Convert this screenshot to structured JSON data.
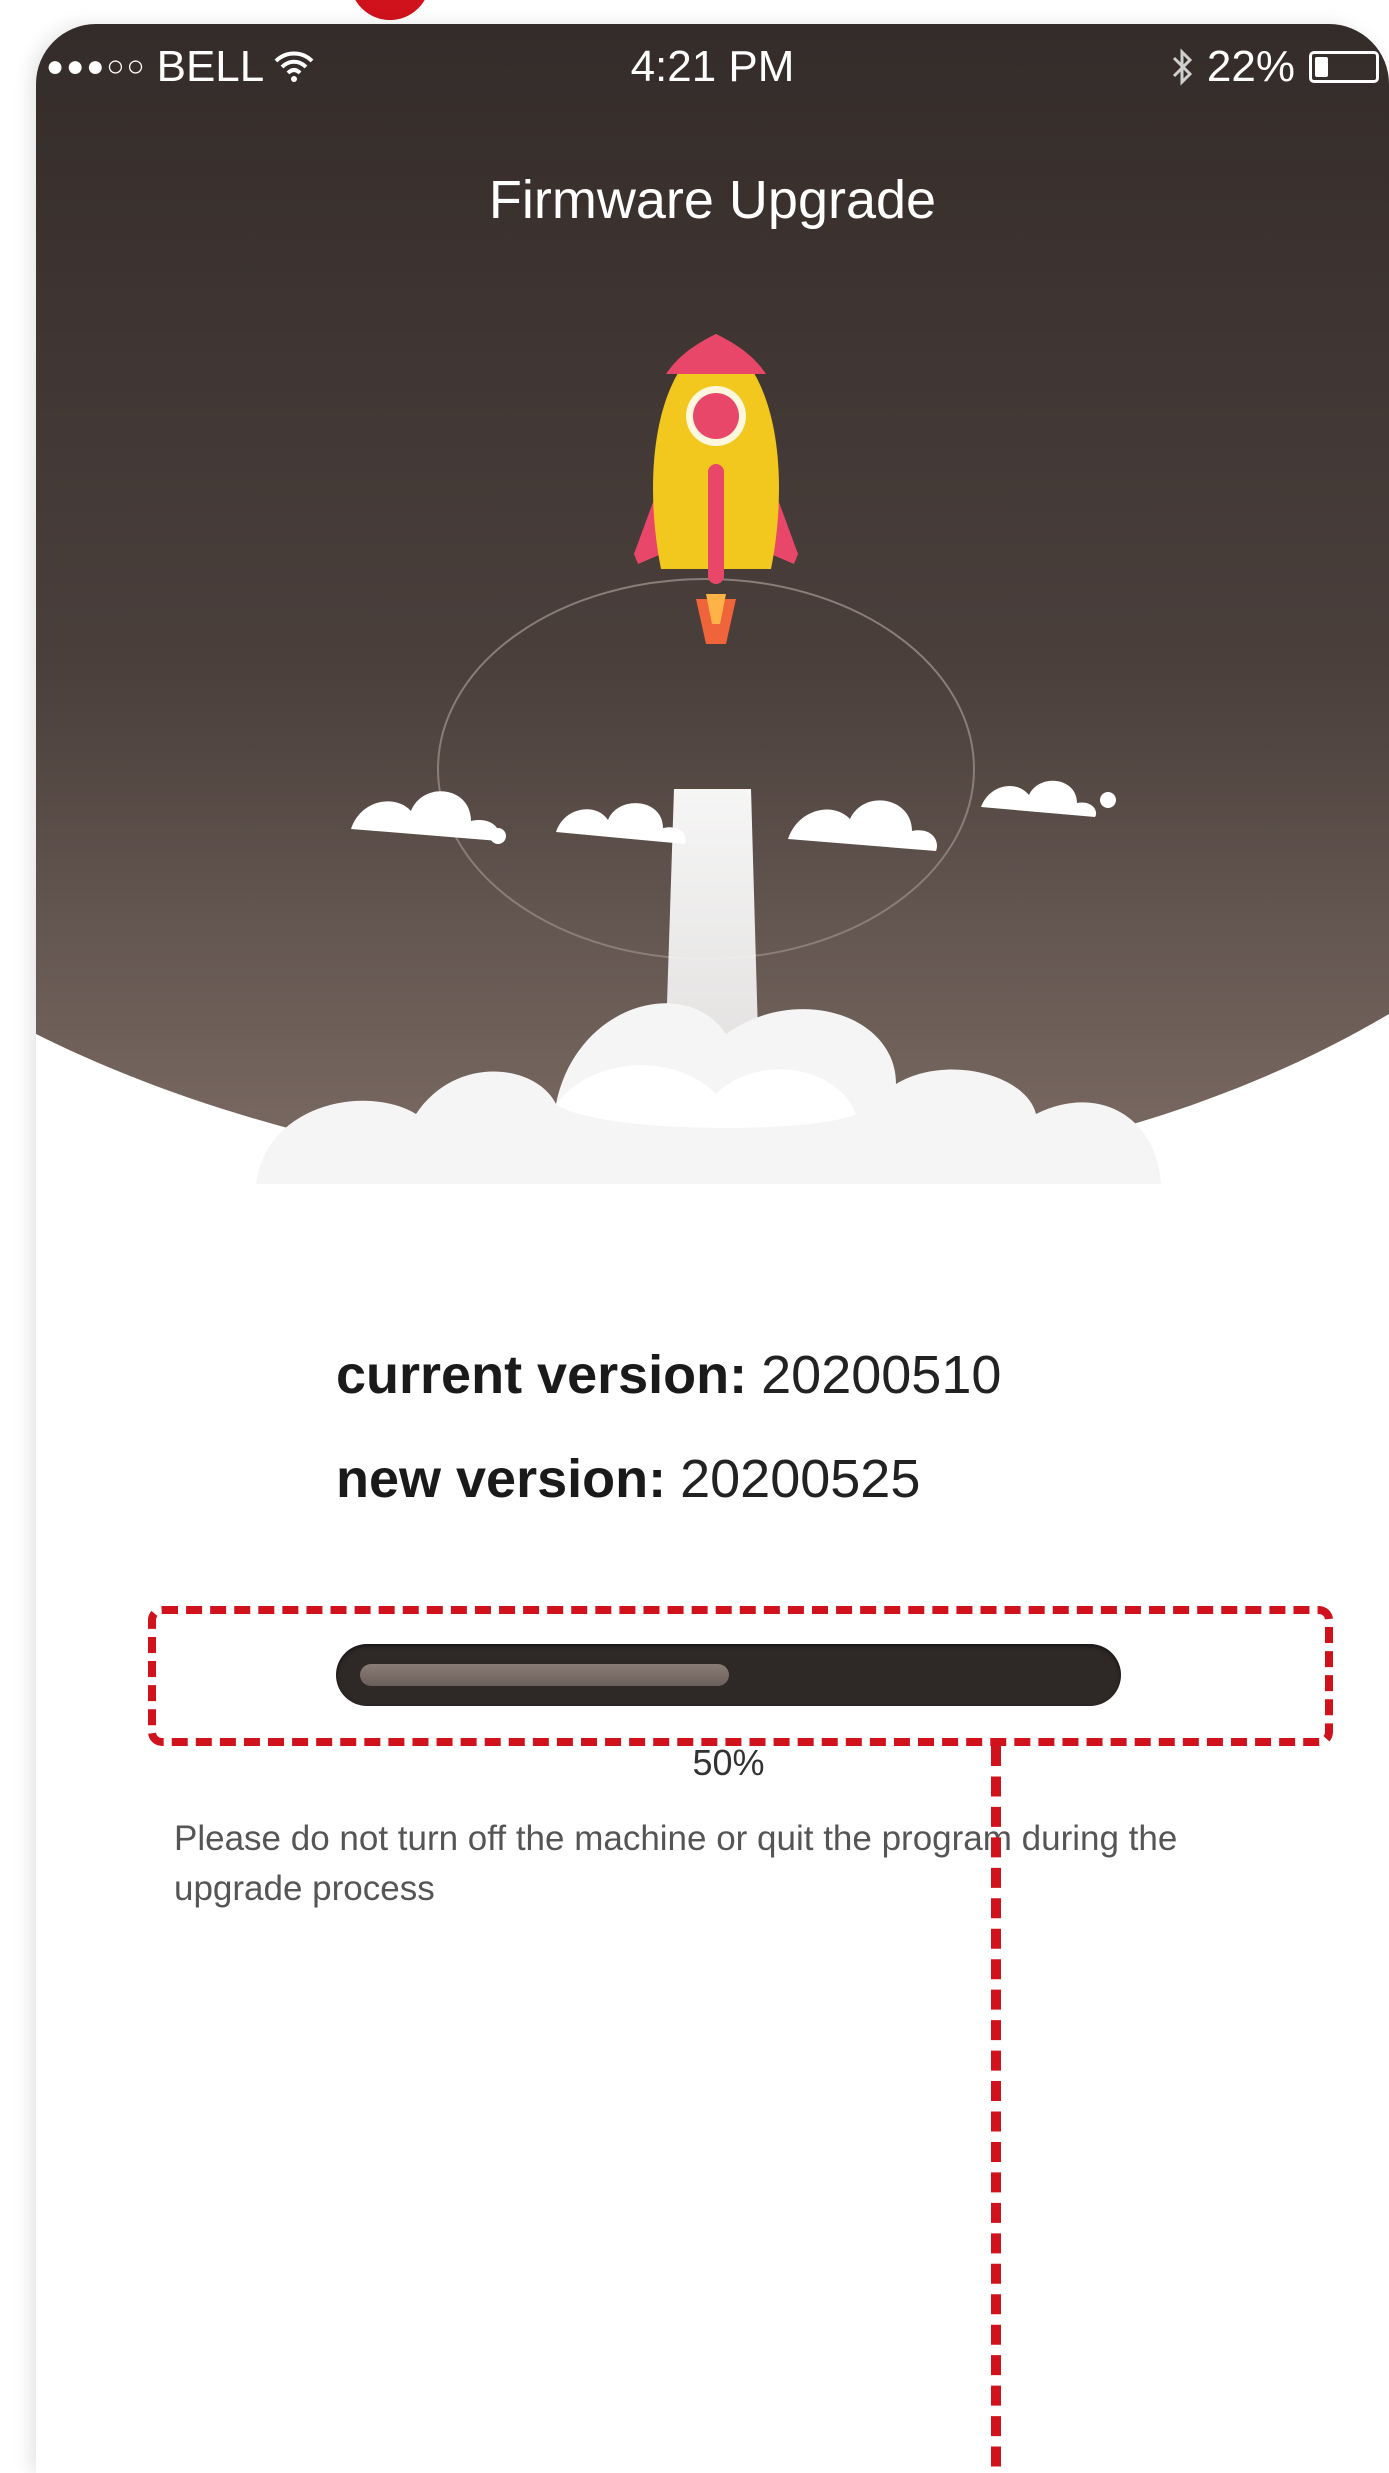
{
  "status_bar": {
    "signal_dots": "●●●○○",
    "carrier": "BELL",
    "wifi_icon": "wifi-icon",
    "time": "4:21 PM",
    "bluetooth_icon": "bluetooth-icon",
    "battery_text": "22%",
    "battery_level": 0.22
  },
  "header": {
    "title": "Firmware Upgrade"
  },
  "illustration": {
    "icon": "rocket-icon",
    "clouds": "cloud-icon"
  },
  "versions": {
    "current_label": "current version:",
    "current_value": "20200510",
    "new_label": "new version:",
    "new_value": "20200525"
  },
  "progress": {
    "value": 0.5,
    "text": "50%"
  },
  "warning": {
    "text": "Please do not turn off the machine or quit the program during the upgrade process"
  },
  "colors": {
    "hero_top": "#3a3230",
    "hero_bottom": "#7a6a63",
    "rocket_body": "#f2c81e",
    "rocket_accent": "#e8476a",
    "annotation": "#d0121c"
  }
}
